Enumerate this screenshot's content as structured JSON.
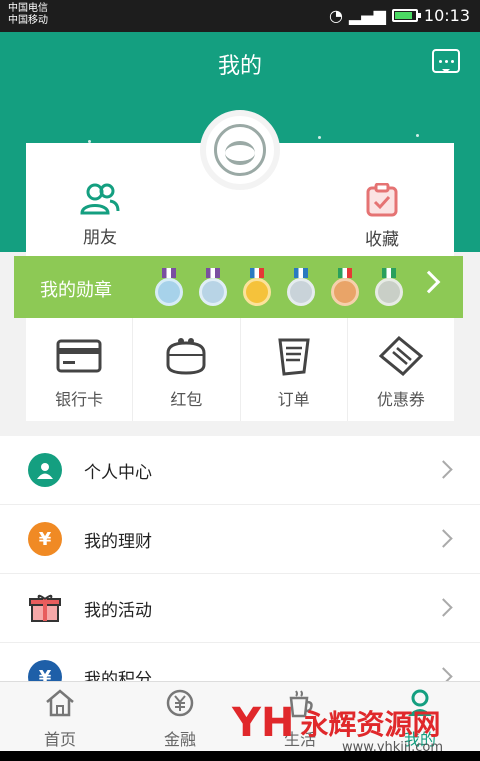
{
  "status_bar": {
    "carrier_1": "中国电信",
    "carrier_2": "中国移动",
    "time": "10:13"
  },
  "header": {
    "title": "我的",
    "background": "#149f80"
  },
  "profile_card": {
    "friends_label": "朋友",
    "favorites_label": "收藏"
  },
  "medals": {
    "label": "我的勋章",
    "count": 6
  },
  "quick_grid": [
    {
      "label": "银行卡",
      "icon": "bank-card-icon"
    },
    {
      "label": "红包",
      "icon": "red-packet-icon"
    },
    {
      "label": "订单",
      "icon": "order-icon"
    },
    {
      "label": "优惠券",
      "icon": "coupon-icon"
    }
  ],
  "menu": [
    {
      "label": "个人中心",
      "icon": "personal-center-icon",
      "color": "#149f80"
    },
    {
      "label": "我的理财",
      "icon": "finance-icon",
      "color": "#f08a24"
    },
    {
      "label": "我的活动",
      "icon": "gift-icon",
      "color": "#e85d5d"
    },
    {
      "label": "我的积分",
      "icon": "points-icon",
      "color": "#1e5fa8"
    }
  ],
  "tabs": [
    {
      "label": "首页",
      "icon": "home-icon"
    },
    {
      "label": "金融",
      "icon": "yuan-icon"
    },
    {
      "label": "生活",
      "icon": "cup-icon"
    },
    {
      "label": "我的",
      "icon": "user-icon",
      "active": true
    }
  ],
  "watermark": {
    "logo": "YH",
    "text": "永辉资源网",
    "url": "www.yhkjjj.com"
  }
}
